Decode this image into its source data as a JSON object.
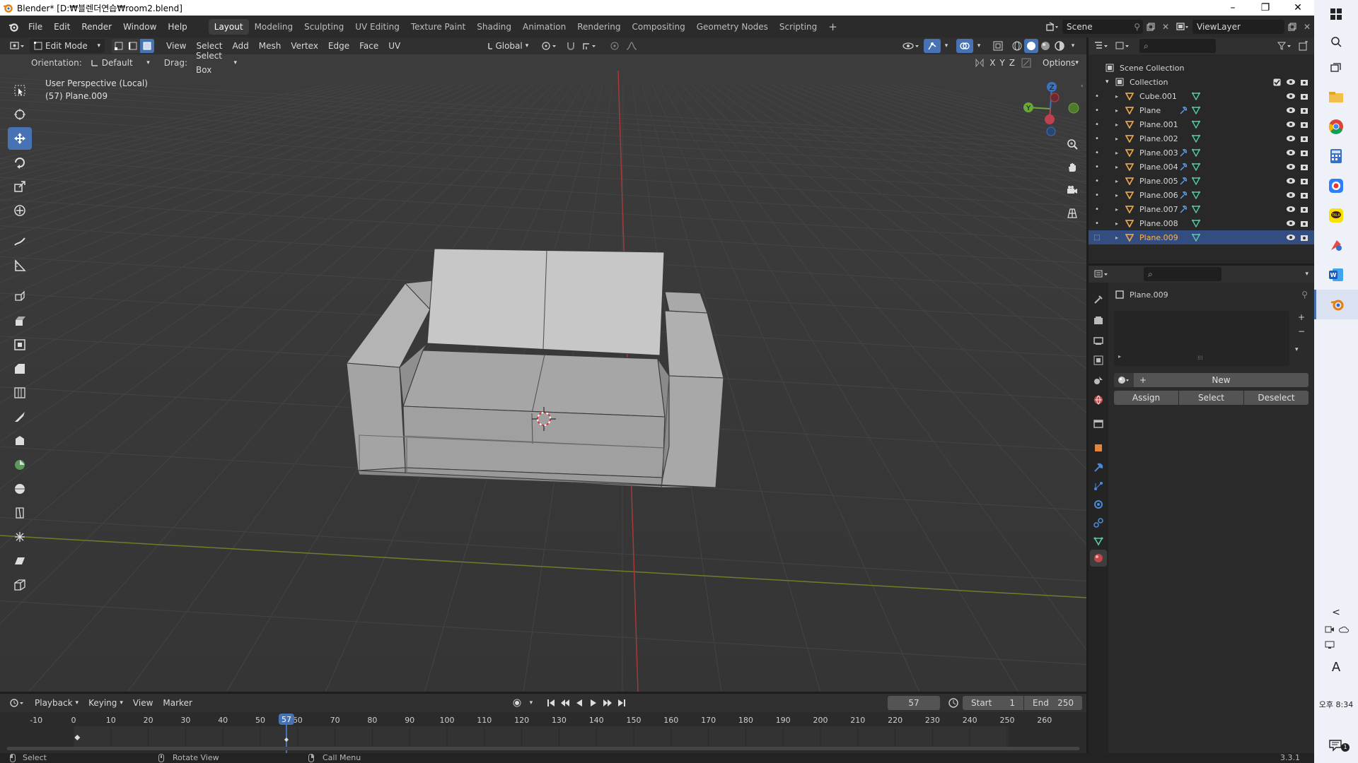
{
  "window": {
    "title": "Blender* [D:₩블렌더연습₩room2.blend]",
    "minimize": "–",
    "restore": "❐",
    "close": "✕"
  },
  "menu": [
    "File",
    "Edit",
    "Render",
    "Window",
    "Help"
  ],
  "workspaces": [
    "Layout",
    "Modeling",
    "Sculpting",
    "UV Editing",
    "Texture Paint",
    "Shading",
    "Animation",
    "Rendering",
    "Compositing",
    "Geometry Nodes",
    "Scripting"
  ],
  "workspace_add": "+",
  "scene": {
    "name": "Scene",
    "view_layer": "ViewLayer"
  },
  "viewport_header": {
    "mode": "Edit Mode",
    "menus": [
      "View",
      "Select",
      "Add",
      "Mesh",
      "Vertex",
      "Edge",
      "Face",
      "UV"
    ],
    "transform_orientation": "Global",
    "orientation_label": "Orientation:",
    "orientation_value": "Default",
    "drag_label": "Drag:",
    "drag_value": "Select Box",
    "axes": [
      "X",
      "Y",
      "Z"
    ],
    "options": "Options"
  },
  "viewport": {
    "perspective": "User Perspective (Local)",
    "object_info": "(57) Plane.009",
    "gizmo": {
      "x": "X",
      "y": "Y",
      "z": "Z"
    }
  },
  "outliner": {
    "root": "Scene Collection",
    "collection": "Collection",
    "items": [
      {
        "name": "Cube.001",
        "modifier": false,
        "selected": false
      },
      {
        "name": "Plane",
        "modifier": true,
        "selected": false
      },
      {
        "name": "Plane.001",
        "modifier": false,
        "selected": false
      },
      {
        "name": "Plane.002",
        "modifier": false,
        "selected": false
      },
      {
        "name": "Plane.003",
        "modifier": true,
        "selected": false
      },
      {
        "name": "Plane.004",
        "modifier": true,
        "selected": false
      },
      {
        "name": "Plane.005",
        "modifier": true,
        "selected": false
      },
      {
        "name": "Plane.006",
        "modifier": true,
        "selected": false
      },
      {
        "name": "Plane.007",
        "modifier": true,
        "selected": false
      },
      {
        "name": "Plane.008",
        "modifier": false,
        "selected": false
      },
      {
        "name": "Plane.009",
        "modifier": false,
        "selected": true
      }
    ]
  },
  "properties": {
    "object_name": "Plane.009",
    "new_button": "New",
    "assign": "Assign",
    "select": "Select",
    "deselect": "Deselect"
  },
  "timeline": {
    "menus": [
      "Playback",
      "Keying",
      "View",
      "Marker"
    ],
    "current_frame": "57",
    "start_label": "Start",
    "start": "1",
    "end_label": "End",
    "end": "250",
    "ticks": [
      "-10",
      "0",
      "10",
      "20",
      "30",
      "40",
      "50",
      "60",
      "70",
      "80",
      "90",
      "100",
      "110",
      "120",
      "130",
      "140",
      "150",
      "160",
      "170",
      "180",
      "190",
      "200",
      "210",
      "220",
      "230",
      "240",
      "250",
      "260"
    ],
    "playhead_label": "57"
  },
  "status": {
    "select": "Select",
    "rotate": "Rotate View",
    "call_menu": "Call Menu",
    "version": "3.3.1"
  },
  "taskbar": {
    "time": "오후 8:34",
    "ime": "A",
    "notification_count": "1",
    "collapse": "<"
  },
  "colors": {
    "accent": "#4772b3",
    "selected_row": "#334d80",
    "active_text": "#ffb54c",
    "mesh_icon": "#e3a04f",
    "data_icon": "#57c9a8"
  }
}
